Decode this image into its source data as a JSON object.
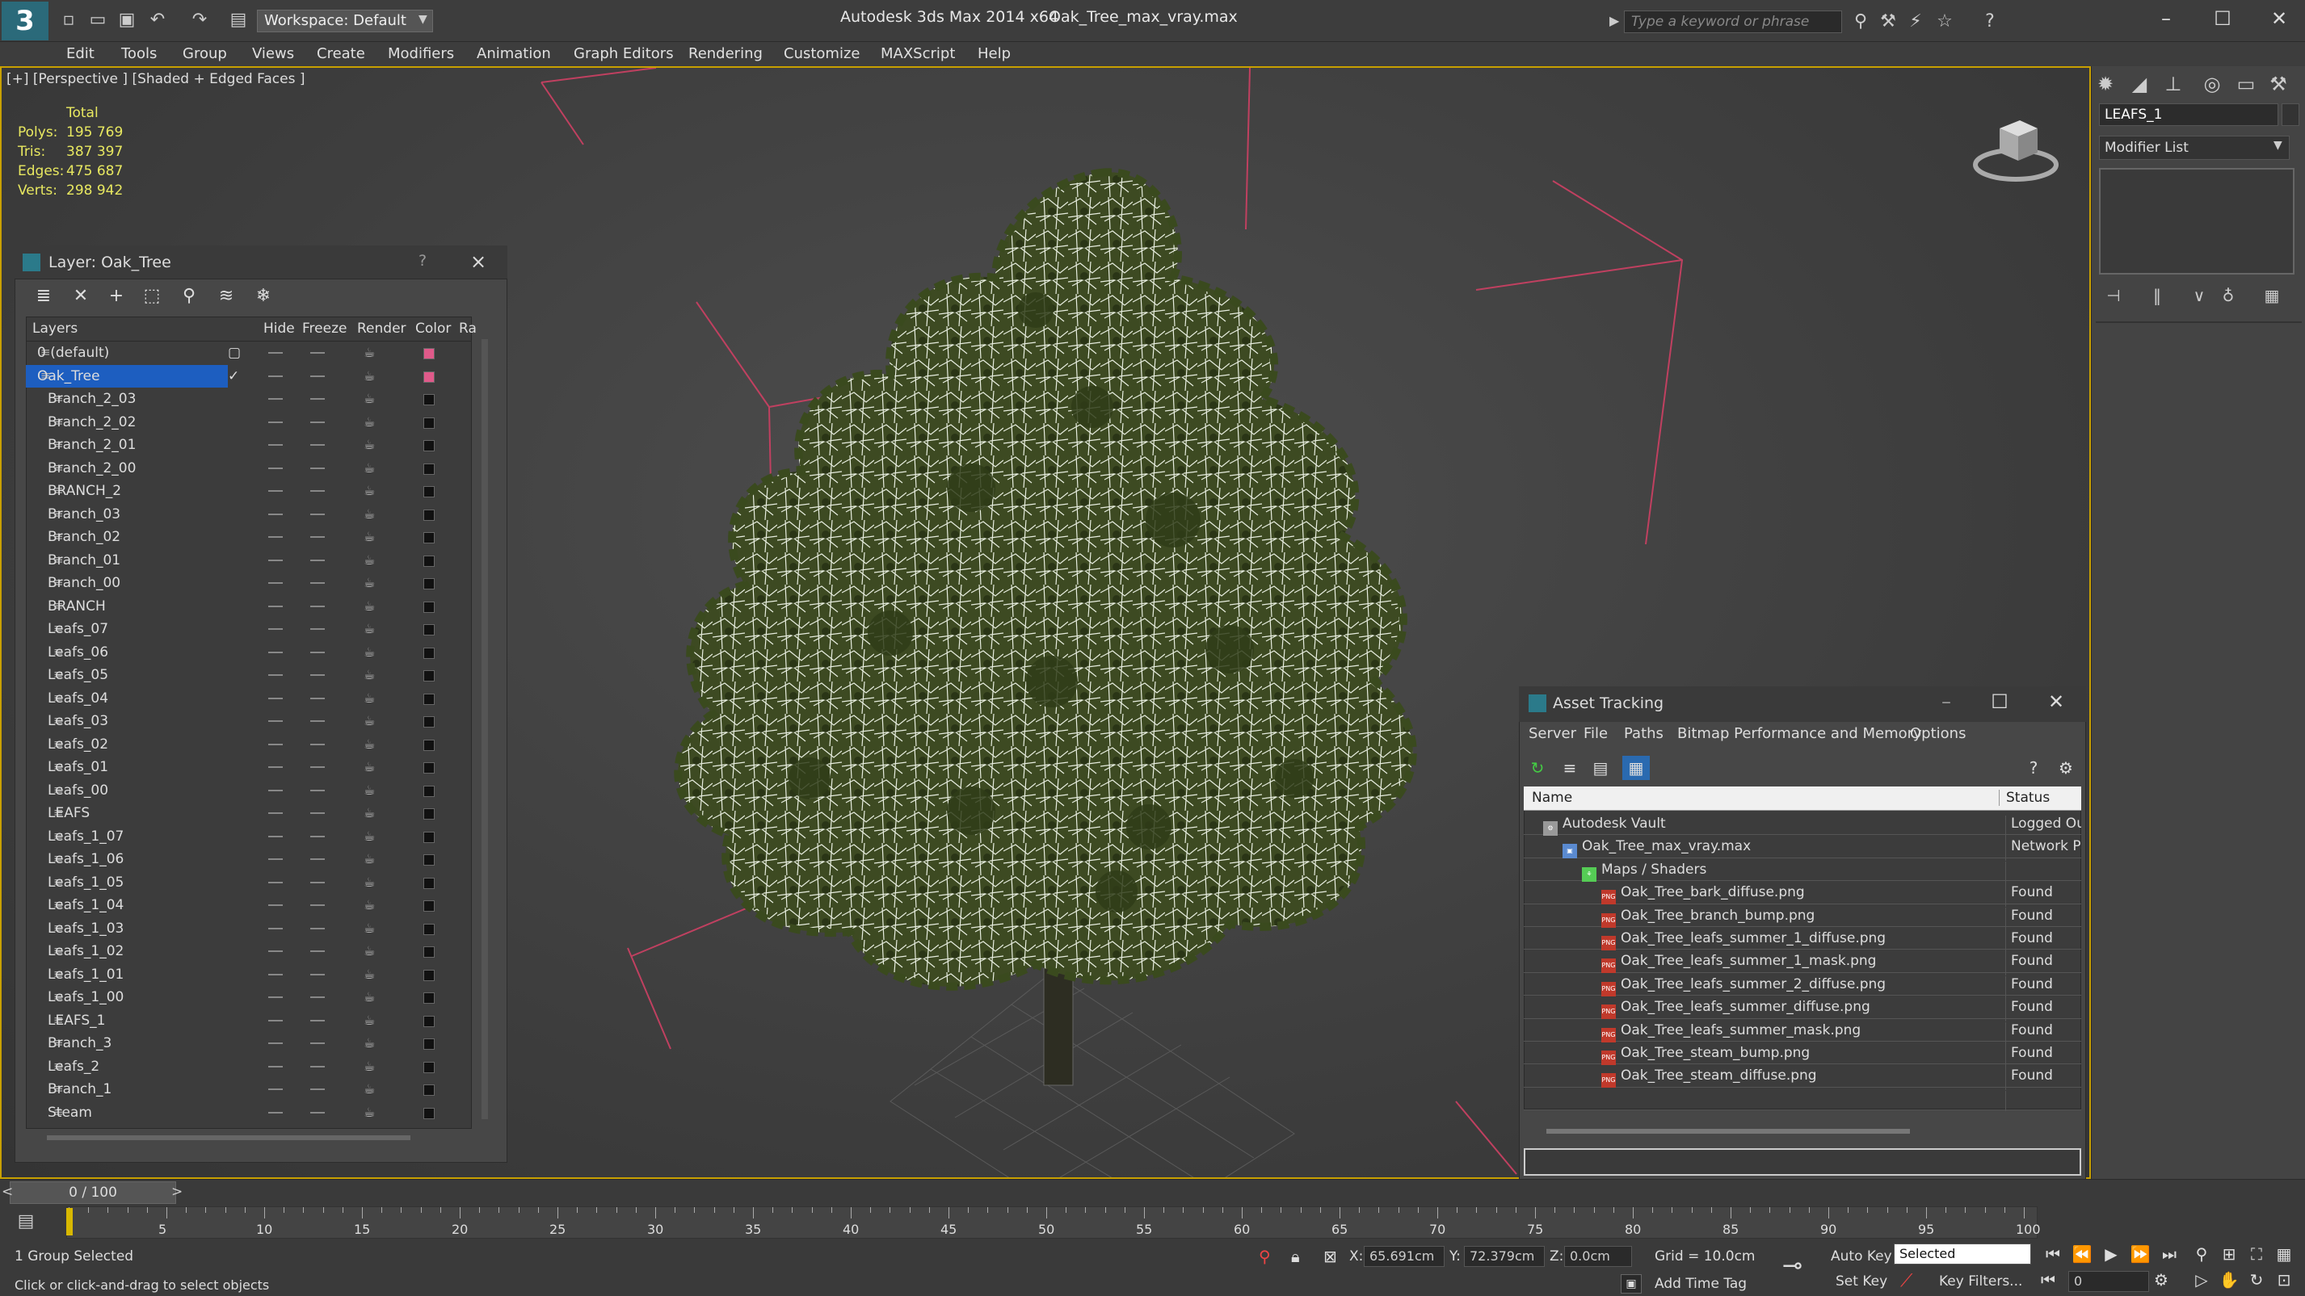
{
  "app": {
    "title": "Autodesk 3ds Max  2014 x64",
    "file": "Oak_Tree_max_vray.max",
    "workspace": "Workspace: Default",
    "search_placeholder": "Type a keyword or phrase",
    "logo": "3"
  },
  "menu": [
    "Edit",
    "Tools",
    "Group",
    "Views",
    "Create",
    "Modifiers",
    "Animation",
    "Graph Editors",
    "Rendering",
    "Customize",
    "MAXScript",
    "Help"
  ],
  "viewport": {
    "label": "[+] [Perspective ] [Shaded + Edged Faces ]",
    "stats_header": "Total",
    "stats": [
      {
        "label": "Polys:",
        "value": "195 769"
      },
      {
        "label": "Tris:",
        "value": "387 397"
      },
      {
        "label": "Edges:",
        "value": "475 687"
      },
      {
        "label": "Verts:",
        "value": "298 942"
      }
    ]
  },
  "command_panel": {
    "object_name": "LEAFS_1",
    "modifier_list": "Modifier List"
  },
  "layer_window": {
    "title": "Layer: Oak_Tree",
    "help": "?",
    "close": "×",
    "columns": {
      "layers": "Layers",
      "hide": "Hide",
      "freeze": "Freeze",
      "render": "Render",
      "color": "Color",
      "radiosity": "Ra"
    },
    "rows": [
      {
        "name": "0 (default)",
        "indent": 0,
        "color": "#e05a8a",
        "check": "box"
      },
      {
        "name": "Oak_Tree",
        "indent": 0,
        "color": "#e05a8a",
        "check": "tick",
        "selected": true
      },
      {
        "name": "Branch_2_03",
        "indent": 1
      },
      {
        "name": "Branch_2_02",
        "indent": 1
      },
      {
        "name": "Branch_2_01",
        "indent": 1
      },
      {
        "name": "Branch_2_00",
        "indent": 1
      },
      {
        "name": "BRANCH_2",
        "indent": 1
      },
      {
        "name": "Branch_03",
        "indent": 1
      },
      {
        "name": "Branch_02",
        "indent": 1
      },
      {
        "name": "Branch_01",
        "indent": 1
      },
      {
        "name": "Branch_00",
        "indent": 1
      },
      {
        "name": "BRANCH",
        "indent": 1
      },
      {
        "name": "Leafs_07",
        "indent": 1
      },
      {
        "name": "Leafs_06",
        "indent": 1
      },
      {
        "name": "Leafs_05",
        "indent": 1
      },
      {
        "name": "Leafs_04",
        "indent": 1
      },
      {
        "name": "Leafs_03",
        "indent": 1
      },
      {
        "name": "Leafs_02",
        "indent": 1
      },
      {
        "name": "Leafs_01",
        "indent": 1
      },
      {
        "name": "Leafs_00",
        "indent": 1
      },
      {
        "name": "LEAFS",
        "indent": 1
      },
      {
        "name": "Leafs_1_07",
        "indent": 1
      },
      {
        "name": "Leafs_1_06",
        "indent": 1
      },
      {
        "name": "Leafs_1_05",
        "indent": 1
      },
      {
        "name": "Leafs_1_04",
        "indent": 1
      },
      {
        "name": "Leafs_1_03",
        "indent": 1
      },
      {
        "name": "Leafs_1_02",
        "indent": 1
      },
      {
        "name": "Leafs_1_01",
        "indent": 1
      },
      {
        "name": "Leafs_1_00",
        "indent": 1
      },
      {
        "name": "LEAFS_1",
        "indent": 1
      },
      {
        "name": "Branch_3",
        "indent": 1
      },
      {
        "name": "Leafs_2",
        "indent": 1
      },
      {
        "name": "Branch_1",
        "indent": 1
      },
      {
        "name": "Steam",
        "indent": 1
      }
    ]
  },
  "asset_window": {
    "title": "Asset Tracking",
    "menu": [
      "Server",
      "File",
      "Paths",
      "Bitmap Performance and Memory",
      "Options"
    ],
    "columns": {
      "name": "Name",
      "status": "Status"
    },
    "rows": [
      {
        "name": "Autodesk Vault",
        "status": "Logged Out",
        "indent": 1,
        "icon": "vault"
      },
      {
        "name": "Oak_Tree_max_vray.max",
        "status": "Network Pa",
        "indent": 2,
        "icon": "max"
      },
      {
        "name": "Maps / Shaders",
        "status": "",
        "indent": 3,
        "icon": "maps"
      },
      {
        "name": "Oak_Tree_bark_diffuse.png",
        "status": "Found",
        "indent": 4,
        "icon": "png"
      },
      {
        "name": "Oak_Tree_branch_bump.png",
        "status": "Found",
        "indent": 4,
        "icon": "png"
      },
      {
        "name": "Oak_Tree_leafs_summer_1_diffuse.png",
        "status": "Found",
        "indent": 4,
        "icon": "png"
      },
      {
        "name": "Oak_Tree_leafs_summer_1_mask.png",
        "status": "Found",
        "indent": 4,
        "icon": "png"
      },
      {
        "name": "Oak_Tree_leafs_summer_2_diffuse.png",
        "status": "Found",
        "indent": 4,
        "icon": "png"
      },
      {
        "name": "Oak_Tree_leafs_summer_diffuse.png",
        "status": "Found",
        "indent": 4,
        "icon": "png"
      },
      {
        "name": "Oak_Tree_leafs_summer_mask.png",
        "status": "Found",
        "indent": 4,
        "icon": "png"
      },
      {
        "name": "Oak_Tree_steam_bump.png",
        "status": "Found",
        "indent": 4,
        "icon": "png"
      },
      {
        "name": "Oak_Tree_steam_diffuse.png",
        "status": "Found",
        "indent": 4,
        "icon": "png"
      }
    ]
  },
  "timeline": {
    "position": "0 / 100",
    "ticks": [
      "5",
      "10",
      "15",
      "20",
      "25",
      "30",
      "35",
      "40",
      "45",
      "50",
      "55",
      "60",
      "65",
      "70",
      "75",
      "80",
      "85",
      "90",
      "95",
      "100"
    ],
    "prev": "<",
    "next": ">"
  },
  "status": {
    "selection": "1 Group Selected",
    "prompt": "Click or click-and-drag to select objects",
    "x_label": "X:",
    "x_value": "65.691cm",
    "y_label": "Y:",
    "y_value": "72.379cm",
    "z_label": "Z:",
    "z_value": "0.0cm",
    "grid": "Grid = 10.0cm",
    "add_time_tag": "Add Time Tag",
    "auto_key": "Auto Key",
    "set_key": "Set Key",
    "selected_dropdown": "Selected",
    "key_filters": "Key Filters...",
    "frame": "0"
  }
}
